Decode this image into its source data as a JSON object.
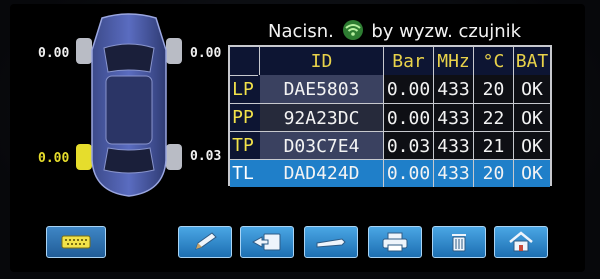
{
  "header": {
    "title_left": "Nacisn.",
    "title_right": "by wyzw. czujnik"
  },
  "tires": {
    "front_left": "0.00",
    "front_right": "0.00",
    "rear_left": "0.00",
    "rear_right": "0.03"
  },
  "table": {
    "columns": [
      "ID",
      "Bar",
      "MHz",
      "°C",
      "BAT"
    ],
    "rows": [
      {
        "label": "LP",
        "id": "DAE5803",
        "bar": "0.00",
        "mhz": "433",
        "temp": "20",
        "bat": "OK"
      },
      {
        "label": "PP",
        "id": "92A23DC",
        "bar": "0.00",
        "mhz": "433",
        "temp": "22",
        "bat": "OK"
      },
      {
        "label": "TP",
        "id": "D03C7E4",
        "bar": "0.03",
        "mhz": "433",
        "temp": "21",
        "bat": "OK"
      },
      {
        "label": "TL",
        "id": "DAD424D",
        "bar": "0.00",
        "mhz": "433",
        "temp": "20",
        "bat": "OK"
      }
    ]
  },
  "toolbar": {
    "buttons": [
      "connector-icon",
      "pencil-icon",
      "transfer-icon",
      "tire-iron-icon",
      "printer-icon",
      "trash-icon",
      "home-icon"
    ]
  },
  "colors": {
    "highlight_row": "#1f7fc9",
    "label_yellow": "#f2e24a",
    "tire_highlight": "#e6dd2c"
  }
}
